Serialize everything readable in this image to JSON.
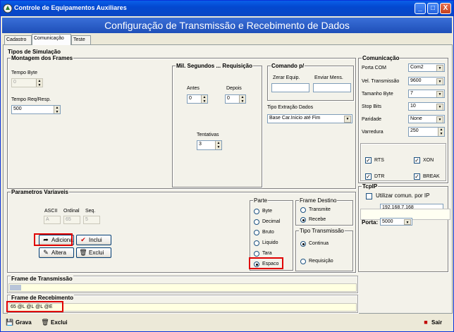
{
  "window": {
    "title": "Controle de Equipamentos Auxiliares",
    "minimize": "_",
    "maximize": "□",
    "close": "X"
  },
  "banner": "Configuração de Transmissão e Recebimento de Dados",
  "tabs": [
    {
      "label": "Cadastro"
    },
    {
      "label": "Comunicação"
    },
    {
      "label": "Teste"
    }
  ],
  "tipos": {
    "title": "Tipos de Simulação"
  },
  "montagem": {
    "title": "Montagem dos Frames",
    "tempo_byte_label": "Tempo Byte",
    "tempo_byte_value": "0",
    "tempo_req_label": "Tempo Req/Resp.",
    "tempo_req_value": "500"
  },
  "mil": {
    "title": "Mil. Segundos ... Requisição",
    "antes_label": "Antes",
    "antes_value": "0",
    "depois_label": "Depois",
    "depois_value": "0",
    "tentativas_label": "Tentativas",
    "tentativas_value": "3"
  },
  "comando": {
    "title": "Comando p/",
    "zerar_label": "Zerar Equip.",
    "zerar_value": "",
    "enviar_label": "Enviar Mens.",
    "enviar_value": "",
    "tipo_extracao_label": "Tipo Extração Dados",
    "tipo_extracao_value": "Base Car.Inicio até Fim"
  },
  "comunicacao": {
    "title": "Comunicação",
    "porta_com_label": "Porta COM",
    "porta_com_value": "Com2",
    "vel_label": "Vel. Transmissão",
    "vel_value": "9600",
    "tamanho_label": "Tamanho Byte",
    "tamanho_value": "7",
    "stop_label": "Stop Bits",
    "stop_value": "10",
    "paridade_label": "Paridade",
    "paridade_value": "None",
    "varredura_label": "Varredura",
    "varredura_value": "250",
    "rts_label": "RTS",
    "xon_label": "XON",
    "dtr_label": "DTR",
    "break_label": "BREAK",
    "check_mark": "✓"
  },
  "tcpip": {
    "title": "TcpIP",
    "utilizar_label": "Utilizar comun. por IP",
    "ip_value": "192.168.7.168",
    "porta_label": "Porta:",
    "porta_value": "5000"
  },
  "parametros": {
    "title": "Parametros Variaveis",
    "ascii_label": "ASCII",
    "ascii_value": "A",
    "ordinal_label": "Ordinal",
    "ordinal_value": "65",
    "seq_label": "Seq.",
    "seq_value": "5",
    "adiciona_label": "Adiciona",
    "inclui_label": "Inclui",
    "altera_label": "Altera",
    "exclui_label": "Exclui"
  },
  "parte": {
    "title": "Parte",
    "options": [
      "Byte",
      "Decimal",
      "Bruto",
      "Liquido",
      "Tara",
      "Espaco"
    ]
  },
  "frame_destino": {
    "title": "Frame Destino",
    "options": [
      "Transmite",
      "Recebe"
    ]
  },
  "tipo_transmissao": {
    "title": "Tipo Transmissão",
    "options": [
      "Continua",
      "Requisição"
    ]
  },
  "frame_transmissao": {
    "title": "Frame de Transmissão",
    "value": ""
  },
  "frame_recebimento": {
    "title": "Frame de Recebimento",
    "value": "65 @L @L @L @E"
  },
  "footer": {
    "grava_label": "Grava",
    "exclui_label": "Exclui",
    "sair_label": "Sair"
  },
  "colors": {
    "titlebar": "#0A5FE8",
    "banner": "#3A6FD8",
    "highlight": "#E00000"
  }
}
